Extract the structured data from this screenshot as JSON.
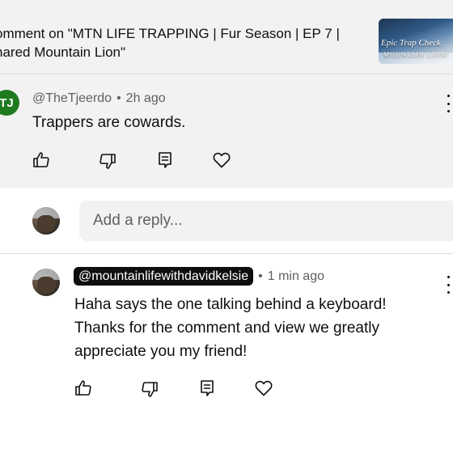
{
  "header": {
    "title": "omment on \"MTN LIFE TRAPPING | Fur Season | EP 7 |\nnared Mountain Lion\"",
    "thumbnail": {
      "line1": "Epic Trap Check",
      "line2": "MOUNTAIN LION!"
    }
  },
  "comment": {
    "avatar_initials": "TJ",
    "avatar_color": "#1f7a1f",
    "author": "@TheTjeerdo",
    "separator": "•",
    "time": "2h ago",
    "text": "Trappers are cowards."
  },
  "reply_box": {
    "placeholder": "Add a reply..."
  },
  "reply": {
    "author": "@mountainlifewithdavidkelsie",
    "separator": "•",
    "time": "1 min ago",
    "text": "Haha says the one talking behind a keyboard! Thanks for the comment and view we greatly appreciate you my friend!"
  },
  "icons": {
    "like": "thumbs-up-icon",
    "dislike": "thumbs-down-icon",
    "reply": "reply-comment-icon",
    "heart": "heart-icon",
    "menu": "more-vertical-icon"
  },
  "colors": {
    "background_top": "#f2f2f2",
    "text_primary": "#0f0f0f",
    "text_secondary": "#606060"
  }
}
